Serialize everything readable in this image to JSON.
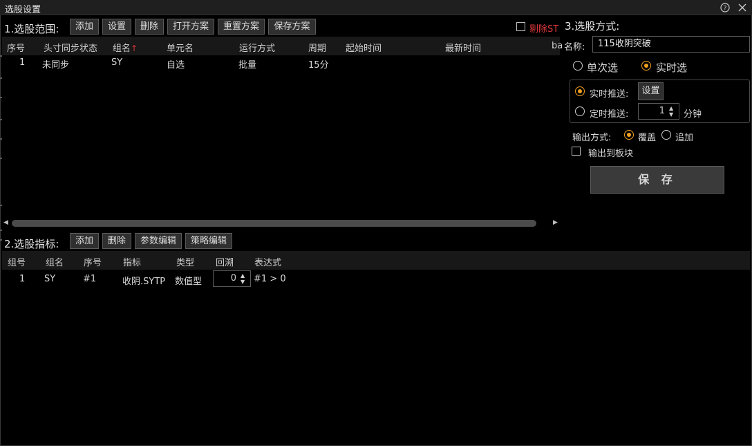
{
  "window": {
    "title": "选股设置",
    "help_icon": "help-circle-icon",
    "close_icon": "close-icon"
  },
  "scope": {
    "label": "1.选股范围:",
    "buttons": [
      "添加",
      "设置",
      "删除",
      "打开方案",
      "重置方案",
      "保存方案"
    ],
    "exclude_st_label": "剔除ST",
    "exclude_st_checked": false,
    "columns": [
      "序号",
      "头寸同步状态",
      "组名",
      "单元名",
      "运行方式",
      "周期",
      "起始时间",
      "最新时间",
      "ba"
    ],
    "sort_indicator": "↑",
    "rows": [
      [
        "1",
        "未同步",
        "SY",
        "自选",
        "批量",
        "15分",
        "",
        "",
        ""
      ]
    ]
  },
  "indicator": {
    "label": "2.选股指标:",
    "buttons": [
      "添加",
      "删除",
      "参数编辑",
      "策略编辑"
    ],
    "columns": [
      "组号",
      "组名",
      "序号",
      "指标",
      "类型",
      "回溯",
      "表达式"
    ],
    "rows": [
      {
        "group_no": "1",
        "group_name": "SY",
        "seq": "#1",
        "indicator": "收阴.SYTP",
        "type": "数值型",
        "lookback": "0",
        "expression": "#1 > 0"
      }
    ]
  },
  "method": {
    "label": "3.选股方式:",
    "name_label": "名称:",
    "name_value": "115收阴突破",
    "mode_single": "单次选",
    "mode_realtime": "实时选",
    "mode_selected": "realtime",
    "push_realtime_label": "实时推送:",
    "push_realtime_button": "设置",
    "push_timed_label": "定时推送:",
    "push_timed_value": "1",
    "push_timed_unit": "分钟",
    "push_selected": "realtime",
    "output_label": "输出方式:",
    "output_overwrite": "覆盖",
    "output_append": "追加",
    "output_selected": "overwrite",
    "output_to_block": "输出到板块",
    "output_to_block_checked": false,
    "save_button": "保 存"
  },
  "colors": {
    "accent_orange": "#f0a020",
    "warning_red": "#e0383b",
    "background": "#000000"
  }
}
